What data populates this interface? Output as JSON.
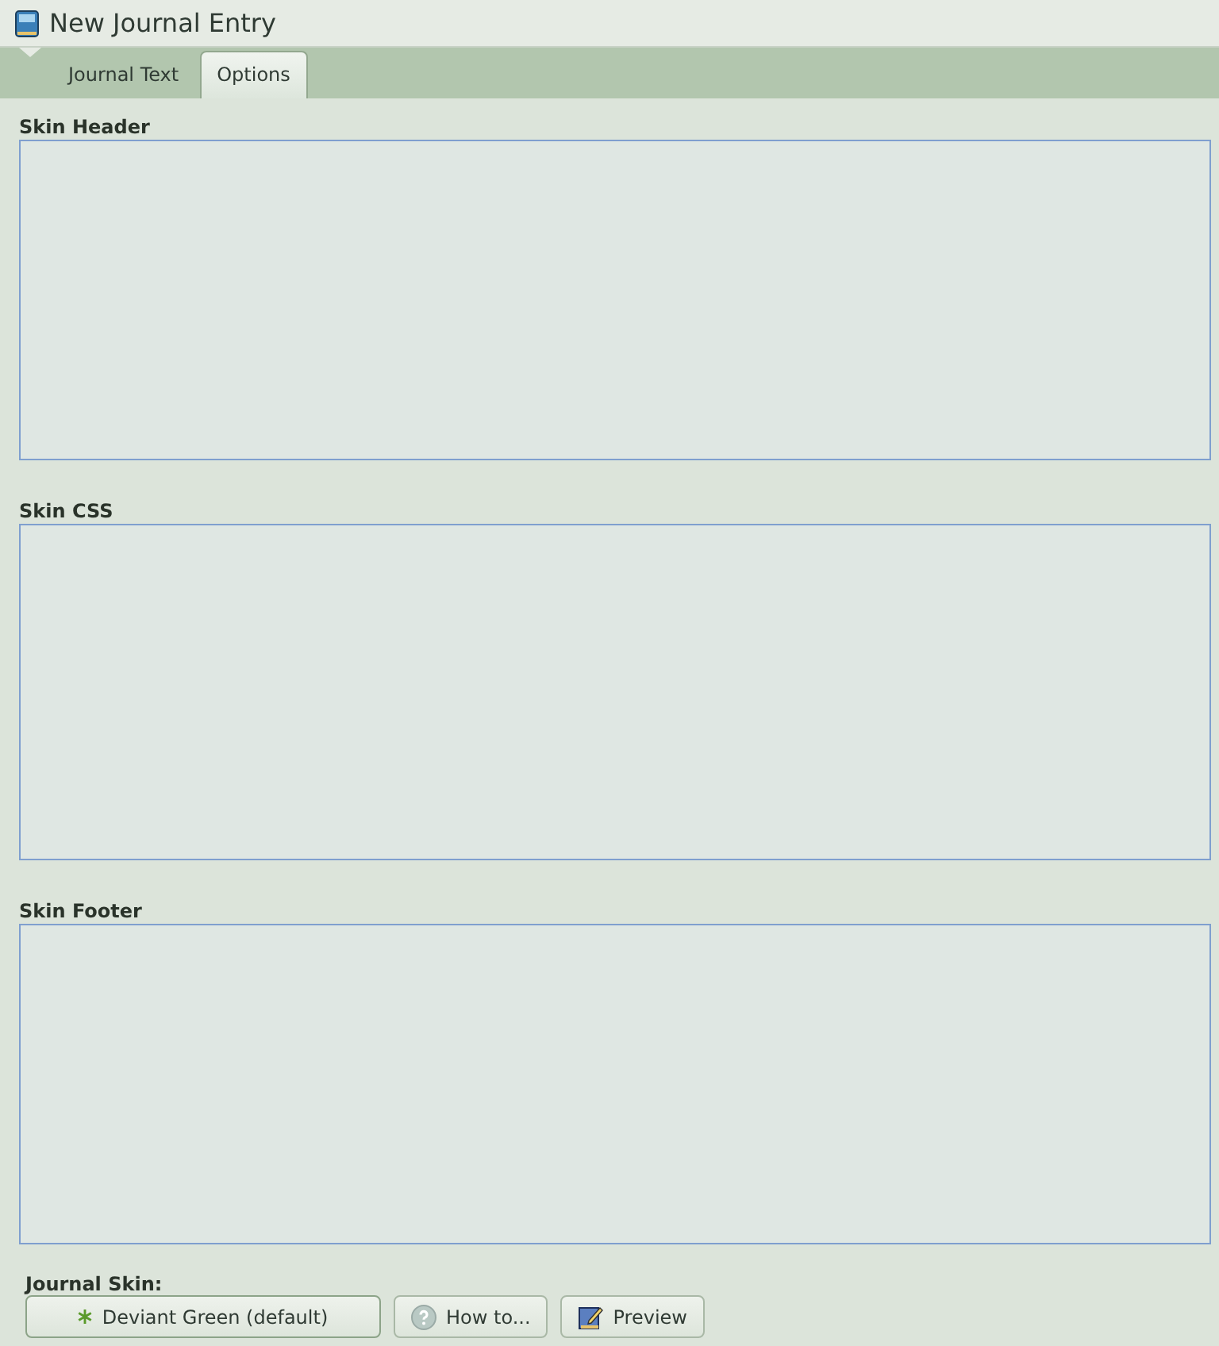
{
  "window": {
    "title": "New Journal Entry"
  },
  "tabs": [
    {
      "label": "Journal Text",
      "selected": false
    },
    {
      "label": "Options",
      "selected": true
    }
  ],
  "fields": [
    {
      "label": "Skin Header"
    },
    {
      "label": "Skin CSS"
    },
    {
      "label": "Skin Footer"
    }
  ],
  "journal_skin": {
    "label": "Journal Skin:",
    "buttons": [
      {
        "kind": "select",
        "label": "Deviant Green (default)"
      },
      {
        "kind": "help",
        "label": "How to..."
      },
      {
        "kind": "preview",
        "label": "Preview"
      }
    ]
  }
}
